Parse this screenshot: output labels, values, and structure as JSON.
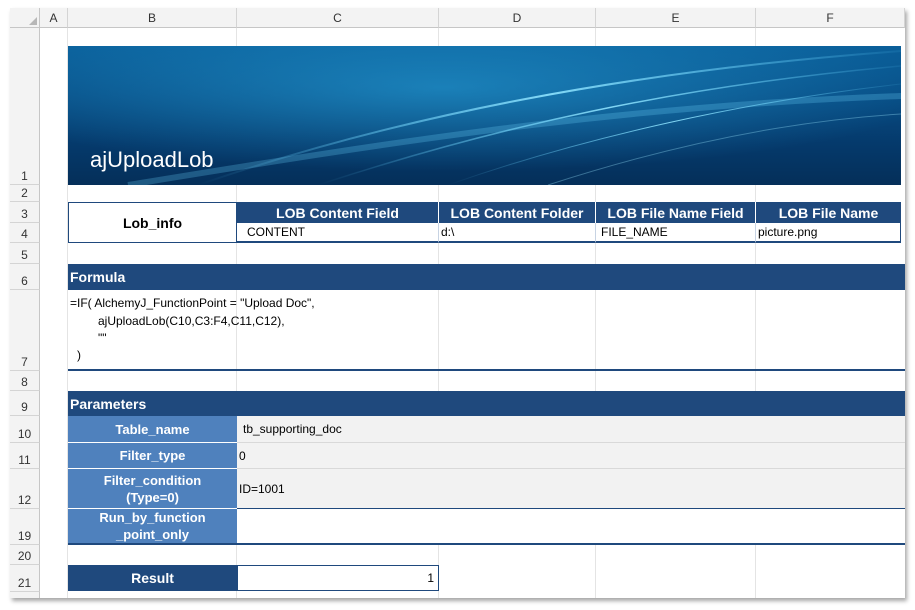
{
  "columns": [
    "A",
    "B",
    "C",
    "D",
    "E",
    "F"
  ],
  "rows": [
    "1",
    "2",
    "3",
    "4",
    "5",
    "6",
    "7",
    "8",
    "9",
    "10",
    "11",
    "12",
    "19",
    "20",
    "21"
  ],
  "banner": {
    "title": "ajUploadLob"
  },
  "lob_info": {
    "label": "Lob_info",
    "headers": [
      "LOB Content Field",
      "LOB Content Folder",
      "LOB File Name Field",
      "LOB File Name"
    ],
    "values": [
      "CONTENT",
      "d:\\",
      "FILE_NAME",
      "picture.png"
    ]
  },
  "formula": {
    "title": "Formula",
    "lines": [
      "=IF( AlchemyJ_FunctionPoint = \"Upload Doc\",",
      "ajUploadLob(C10,C3:F4,C11,C12),",
      "\"\"",
      ")"
    ]
  },
  "parameters": {
    "title": "Parameters",
    "items": [
      {
        "label": "Table_name",
        "value": "tb_supporting_doc"
      },
      {
        "label": "Filter_type",
        "value": "0"
      },
      {
        "label": "Filter_condition\n(Type=0)",
        "value": "ID=1001"
      },
      {
        "label": "Run_by_function\n_point_only",
        "value": ""
      }
    ]
  },
  "result": {
    "label": "Result",
    "value": "1"
  },
  "colors": {
    "header_dark_blue": "#1f497d",
    "label_blue": "#4f81bd",
    "banner_blue": "#074d85"
  }
}
